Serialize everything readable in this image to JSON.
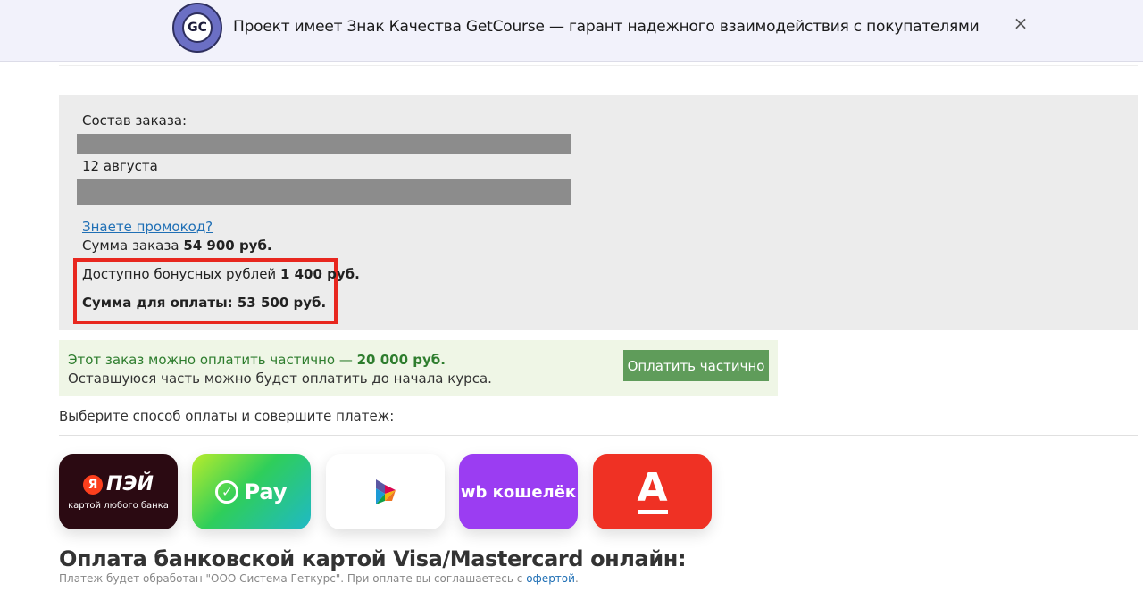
{
  "banner": {
    "badge_ring_text": "ПРОВЕРЕНО GETCOURSE",
    "badge_logo": "GC",
    "text": "Проект имеет Знак Качества GetCourse — гарант надежного взаимодействия с покупателями",
    "close_icon": "×"
  },
  "order": {
    "title": "Состав заказа:",
    "date": "12 августа",
    "promo_link": "Знаете промокод?",
    "sum_label": "Сумма заказа ",
    "sum_value": "54 900 руб.",
    "bonus_label": "Доступно бонусных рублей ",
    "bonus_value": "1 400 руб.",
    "pay_label": "Сумма для оплаты: 53 500 руб."
  },
  "partial": {
    "line1_prefix": "Этот заказ можно оплатить частично — ",
    "line1_value": "20 000 руб.",
    "line2": "Оставшуюся часть можно будет оплатить до начала курса.",
    "button": "Оплатить частично"
  },
  "payment": {
    "choose_label": "Выберите способ оплаты и совершите платеж:",
    "methods": {
      "yandex": {
        "brand": "Я",
        "name": "ПЭЙ",
        "sub": "картой любого банка"
      },
      "sber": {
        "name": "Pay"
      },
      "sbp": {
        "icon": "sbp-logo-icon"
      },
      "wb": {
        "name": "wb кошелёк"
      },
      "alfa": {
        "letter": "А"
      }
    }
  },
  "card": {
    "title": "Оплата банковской картой Visa/Mastercard онлайн:",
    "note_prefix": "Платеж будет обработан \"ООО Система Геткурс\". При оплате вы соглашаетесь с ",
    "note_link": "офертой",
    "note_suffix": "."
  },
  "colors": {
    "accent_red": "#e8271f",
    "partial_green": "#5f9c5a",
    "link_blue": "#1f6fb5"
  }
}
